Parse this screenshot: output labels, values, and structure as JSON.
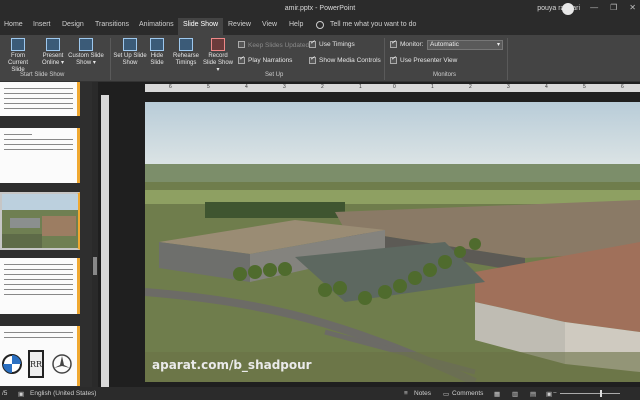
{
  "window": {
    "title": "amir.pptx  -  PowerPoint",
    "user": "pouya rahbari",
    "controls": [
      "—",
      "❐",
      "✕"
    ]
  },
  "tabs": [
    {
      "label": "Home"
    },
    {
      "label": "Insert"
    },
    {
      "label": "Design"
    },
    {
      "label": "Transitions"
    },
    {
      "label": "Animations"
    },
    {
      "label": "Slide Show",
      "active": true
    },
    {
      "label": "Review"
    },
    {
      "label": "View"
    },
    {
      "label": "Help"
    }
  ],
  "tell_me": "Tell me what you want to do",
  "ribbon": {
    "start_group_label": "Start Slide Show",
    "from_current": "From Current Slide",
    "present_online": "Present Online ▾",
    "custom_show": "Custom Slide Show ▾",
    "setup_group_label": "Set Up",
    "set_up": "Set Up Slide Show",
    "hide_slide": "Hide Slide",
    "rehearse": "Rehearse Timings",
    "record": "Record Slide Show ▾",
    "keep_updated": "Keep Slides Updated",
    "play_narrations": "Play Narrations",
    "use_timings": "Use Timings",
    "show_media": "Show Media Controls",
    "monitors_group_label": "Monitors",
    "monitor_label": "Monitor:",
    "monitor_value": "Automatic",
    "presenter_view": "Use Presenter View"
  },
  "ruler_numbers": [
    "6",
    "5",
    "4",
    "3",
    "2",
    "1",
    "0",
    "1",
    "2",
    "3",
    "4",
    "5",
    "6"
  ],
  "watermark": "aparat.com/b_shadpour",
  "status": {
    "slide_info": "/5",
    "language": "English (United States)",
    "notes": "Notes",
    "comments": "Comments"
  },
  "colors": {
    "accent_thumb": "#f0a830",
    "ribbon_bg": "#444444",
    "title_bg": "#2b2b2b"
  }
}
